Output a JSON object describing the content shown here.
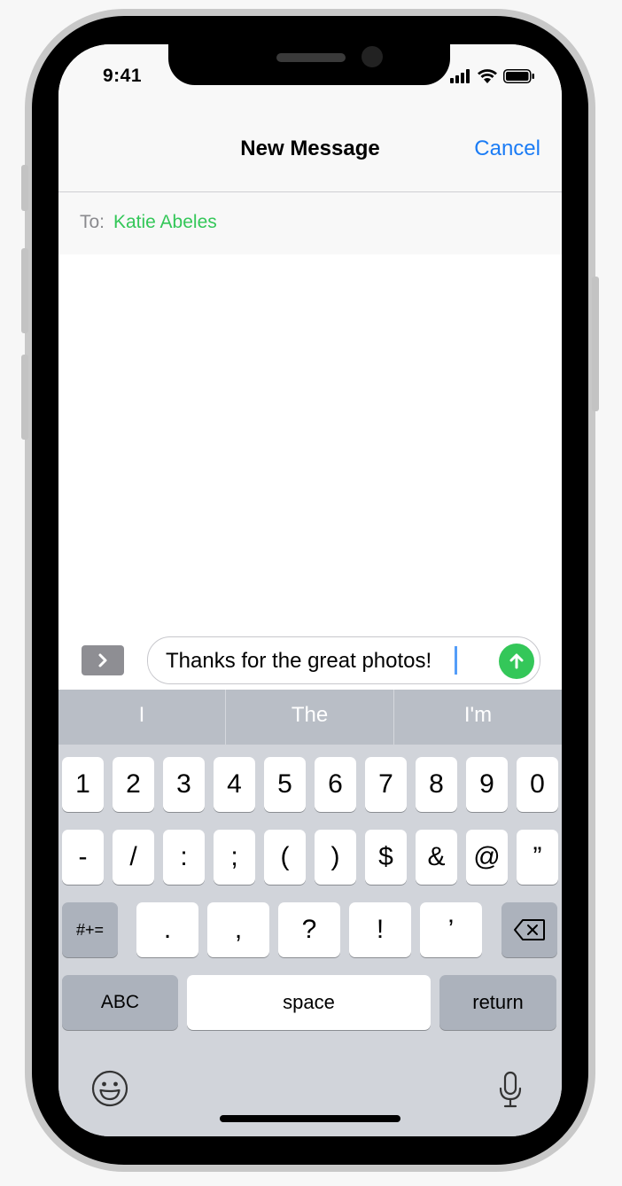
{
  "status": {
    "time": "9:41"
  },
  "nav": {
    "title": "New Message",
    "cancel_label": "Cancel"
  },
  "to": {
    "label": "To:",
    "recipient": "Katie Abeles"
  },
  "compose": {
    "message_text": "Thanks for the great photos!"
  },
  "keyboard": {
    "suggestions": [
      "I",
      "The",
      "I'm"
    ],
    "row1": [
      "1",
      "2",
      "3",
      "4",
      "5",
      "6",
      "7",
      "8",
      "9",
      "0"
    ],
    "row2": [
      "-",
      "/",
      ":",
      ";",
      "(",
      ")",
      "$",
      "&",
      "@",
      "”"
    ],
    "row3": {
      "mode_key": "#+=",
      "keys": [
        ".",
        ",",
        "?",
        "!",
        "’"
      ]
    },
    "row4": {
      "abc_label": "ABC",
      "space_label": "space",
      "return_label": "return"
    }
  },
  "icons": {
    "status": [
      "signal-icon",
      "wifi-icon",
      "battery-icon"
    ],
    "compose": [
      "chevron-right-icon",
      "send-arrow-icon"
    ],
    "keyboard": [
      "delete-icon",
      "emoji-icon",
      "microphone-icon"
    ]
  },
  "colors": {
    "accent_blue": "#1b7cf5",
    "green": "#34c759",
    "keyboard_bg": "#d1d4da"
  }
}
